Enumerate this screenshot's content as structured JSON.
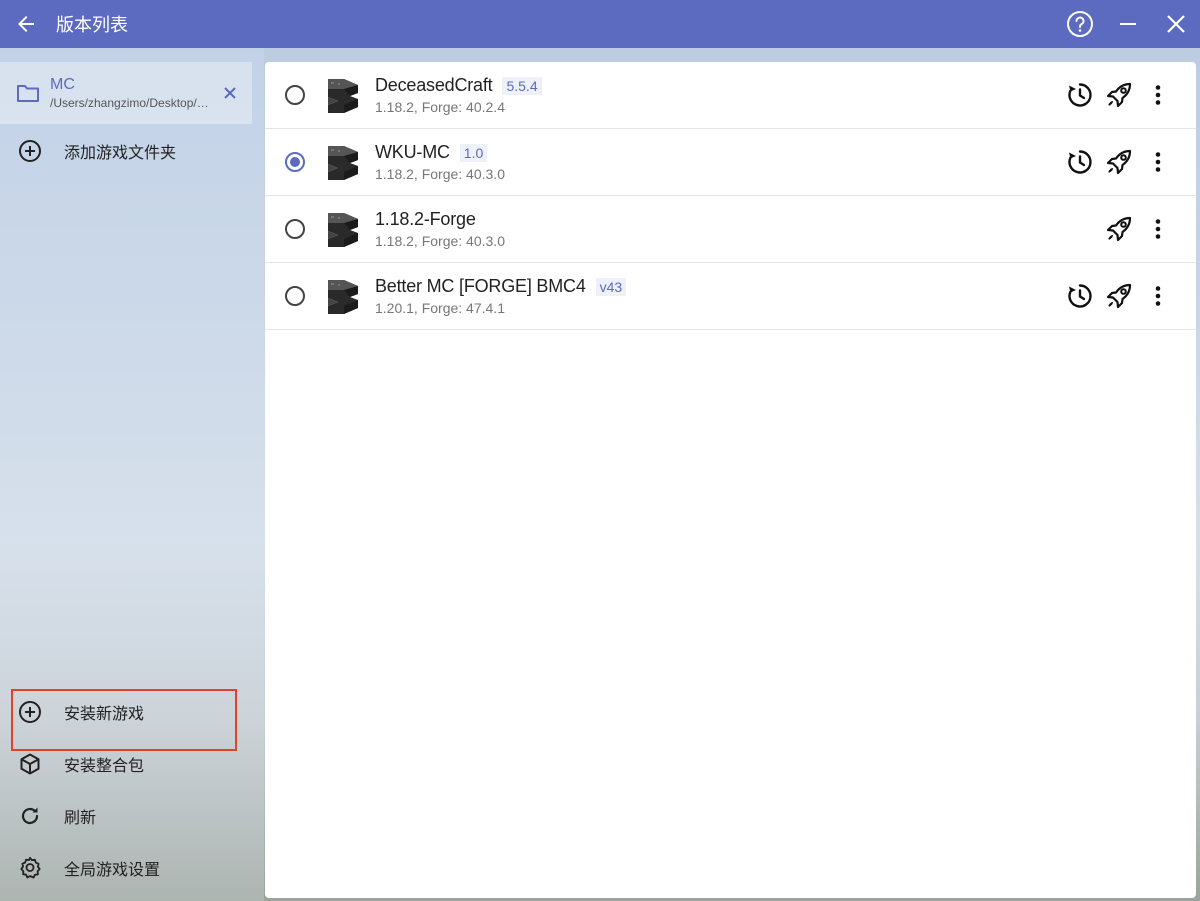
{
  "titlebar": {
    "title": "版本列表",
    "back_icon": "arrow-left-icon",
    "help_icon": "help-circle-icon",
    "minimize_icon": "minimize-icon",
    "close_icon": "close-icon"
  },
  "sidebar": {
    "folder": {
      "name": "MC",
      "path": "/Users/zhangzimo/Desktop/MC"
    },
    "add_folder_label": "添加游戏文件夹",
    "bottom_items": [
      {
        "label": "安装新游戏",
        "icon": "plus-circle-icon"
      },
      {
        "label": "安装整合包",
        "icon": "package-icon"
      },
      {
        "label": "刷新",
        "icon": "refresh-icon"
      },
      {
        "label": "全局游戏设置",
        "icon": "gear-icon"
      }
    ]
  },
  "versions": [
    {
      "name": "DeceasedCraft",
      "tag": "5.5.4",
      "sub": "1.18.2, Forge: 40.2.4",
      "selected": false,
      "has_update": true
    },
    {
      "name": "WKU-MC",
      "tag": "1.0",
      "sub": "1.18.2, Forge: 40.3.0",
      "selected": true,
      "has_update": true
    },
    {
      "name": "1.18.2-Forge",
      "tag": "",
      "sub": "1.18.2, Forge: 40.3.0",
      "selected": false,
      "has_update": false
    },
    {
      "name": "Better MC [FORGE] BMC4",
      "tag": "v43",
      "sub": "1.20.1, Forge: 47.4.1",
      "selected": false,
      "has_update": true
    }
  ],
  "colors": {
    "accent": "#5c6bc0",
    "highlight": "#e0432d"
  }
}
